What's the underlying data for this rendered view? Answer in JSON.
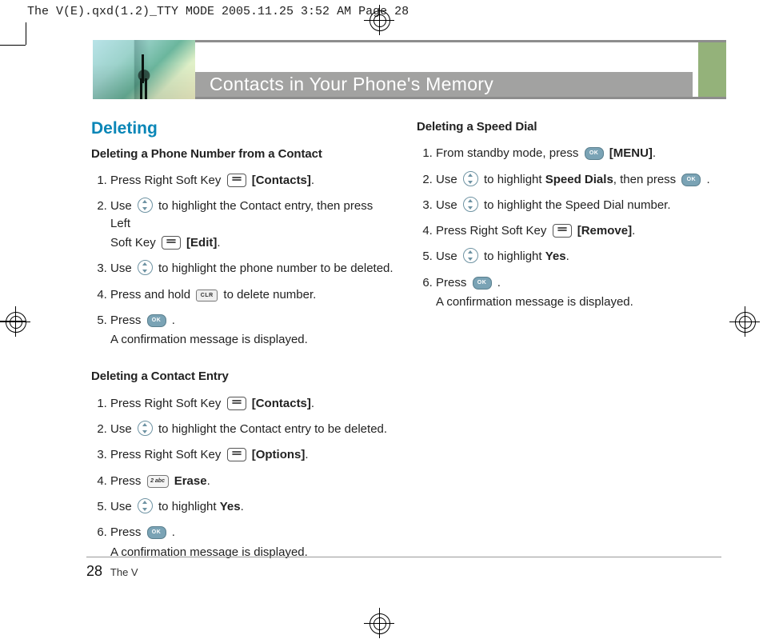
{
  "slug": "The V(E).qxd(1.2)_TTY MODE  2005.11.25  3:52 AM  Page 28",
  "banner_title": "Contacts in Your Phone's Memory",
  "footer": {
    "page": "28",
    "doc": "The V"
  },
  "left": {
    "section": "Deleting",
    "sub1": "Deleting a Phone Number from a Contact",
    "s1": {
      "l1a": "Press Right Soft Key ",
      "l1b": "[Contacts]",
      "l1c": ".",
      "l2a": "Use ",
      "l2b": " to highlight the Contact entry, then press Left",
      "l2c": "Soft Key ",
      "l2d": "[Edit]",
      "l2e": ".",
      "l3a": "Use ",
      "l3b": " to highlight the phone number to be deleted.",
      "l4a": "Press and hold ",
      "l4b": " to delete number.",
      "l5a": "Press ",
      "l5b": " .",
      "l5c": "A confirmation message is displayed."
    },
    "sub2": "Deleting a Contact Entry",
    "s2": {
      "l1a": "Press Right Soft Key ",
      "l1b": "[Contacts]",
      "l1c": ".",
      "l2a": "Use ",
      "l2b": " to highlight the Contact entry to be deleted.",
      "l3a": "Press Right Soft Key ",
      "l3b": "[Options]",
      "l3c": ".",
      "l4a": "Press ",
      "l4b": "Erase",
      "l4c": ".",
      "l5a": "Use ",
      "l5b": " to highlight ",
      "l5c": "Yes",
      "l5d": ".",
      "l6a": "Press ",
      "l6b": " .",
      "l6c": "A confirmation message is displayed."
    }
  },
  "right": {
    "sub": "Deleting a Speed Dial",
    "s": {
      "l1a": "From standby mode, press ",
      "l1b": "[MENU]",
      "l1c": ".",
      "l2a": "Use ",
      "l2b": " to highlight ",
      "l2c": "Speed Dials",
      "l2d": ", then press ",
      "l2e": " .",
      "l3a": "Use ",
      "l3b": " to highlight the Speed Dial number.",
      "l4a": "Press Right Soft Key ",
      "l4b": "[Remove]",
      "l4c": ".",
      "l5a": "Use ",
      "l5b": " to highlight ",
      "l5c": "Yes",
      "l5d": ".",
      "l6a": "Press ",
      "l6b": " .",
      "l6c": "A confirmation message is displayed."
    }
  }
}
